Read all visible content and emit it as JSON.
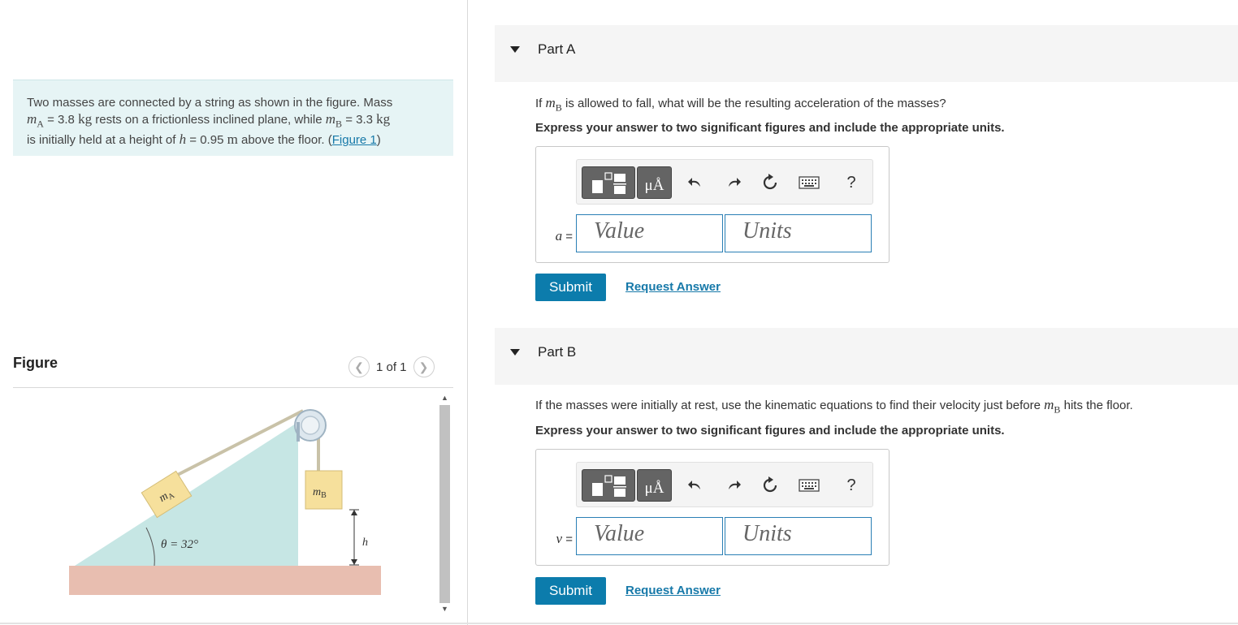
{
  "intro": {
    "t1": "Two masses are connected by a string as shown in the figure. Mass",
    "mA_sym": "m",
    "mA_sub": "A",
    "eq1": " = 3.8 ",
    "kg1": "kg",
    "t2": " rests on a frictionless inclined plane, while ",
    "mB_sym": "m",
    "mB_sub": "B",
    "eq2": " = 3.3 ",
    "kg2": "kg",
    "t3": "is initially held at a height of ",
    "h_sym": "h",
    "eq3": " = 0.95 ",
    "m_unit": "m",
    "t4": " above the floor. (",
    "figure_link": "Figure 1",
    "t5": ")"
  },
  "figure": {
    "title": "Figure",
    "pager": "1 of 1",
    "labels": {
      "mA": "m",
      "mA_sub": "A",
      "mB": "m",
      "mB_sub": "B",
      "theta": "θ = 32°",
      "h": "h"
    }
  },
  "colors": {
    "accent": "#0c7cac",
    "link": "#1779a9",
    "intro_bg": "#e6f4f5",
    "incline": "#c6e6e4",
    "floor": "#e8beb0",
    "block": "#f6e09c"
  },
  "partA": {
    "title": "Part A",
    "q_pre": "If ",
    "q_sym": "m",
    "q_sub": "B",
    "q_post": " is allowed to fall, what will be the resulting acceleration of the masses?",
    "instruction": "Express your answer to two significant figures and include the appropriate units.",
    "var": "a",
    "eq": " =",
    "value_placeholder": "Value",
    "units_placeholder": "Units",
    "unit_btn": "μÅ",
    "help": "?",
    "submit": "Submit",
    "request": "Request Answer"
  },
  "partB": {
    "title": "Part B",
    "q_pre": "If the masses were initially at rest, use the kinematic equations to find their velocity just before ",
    "q_sym": "m",
    "q_sub": "B",
    "q_post": " hits the floor.",
    "instruction": "Express your answer to two significant figures and include the appropriate units.",
    "var": "v",
    "eq": " =",
    "value_placeholder": "Value",
    "units_placeholder": "Units",
    "unit_btn": "μÅ",
    "help": "?",
    "submit": "Submit",
    "request": "Request Answer"
  },
  "icons": [
    "templates-icon",
    "units-icon",
    "undo-icon",
    "redo-icon",
    "reset-icon",
    "keyboard-icon",
    "help-icon",
    "collapse-triangle-icon",
    "chevron-left-icon",
    "chevron-right-icon"
  ]
}
